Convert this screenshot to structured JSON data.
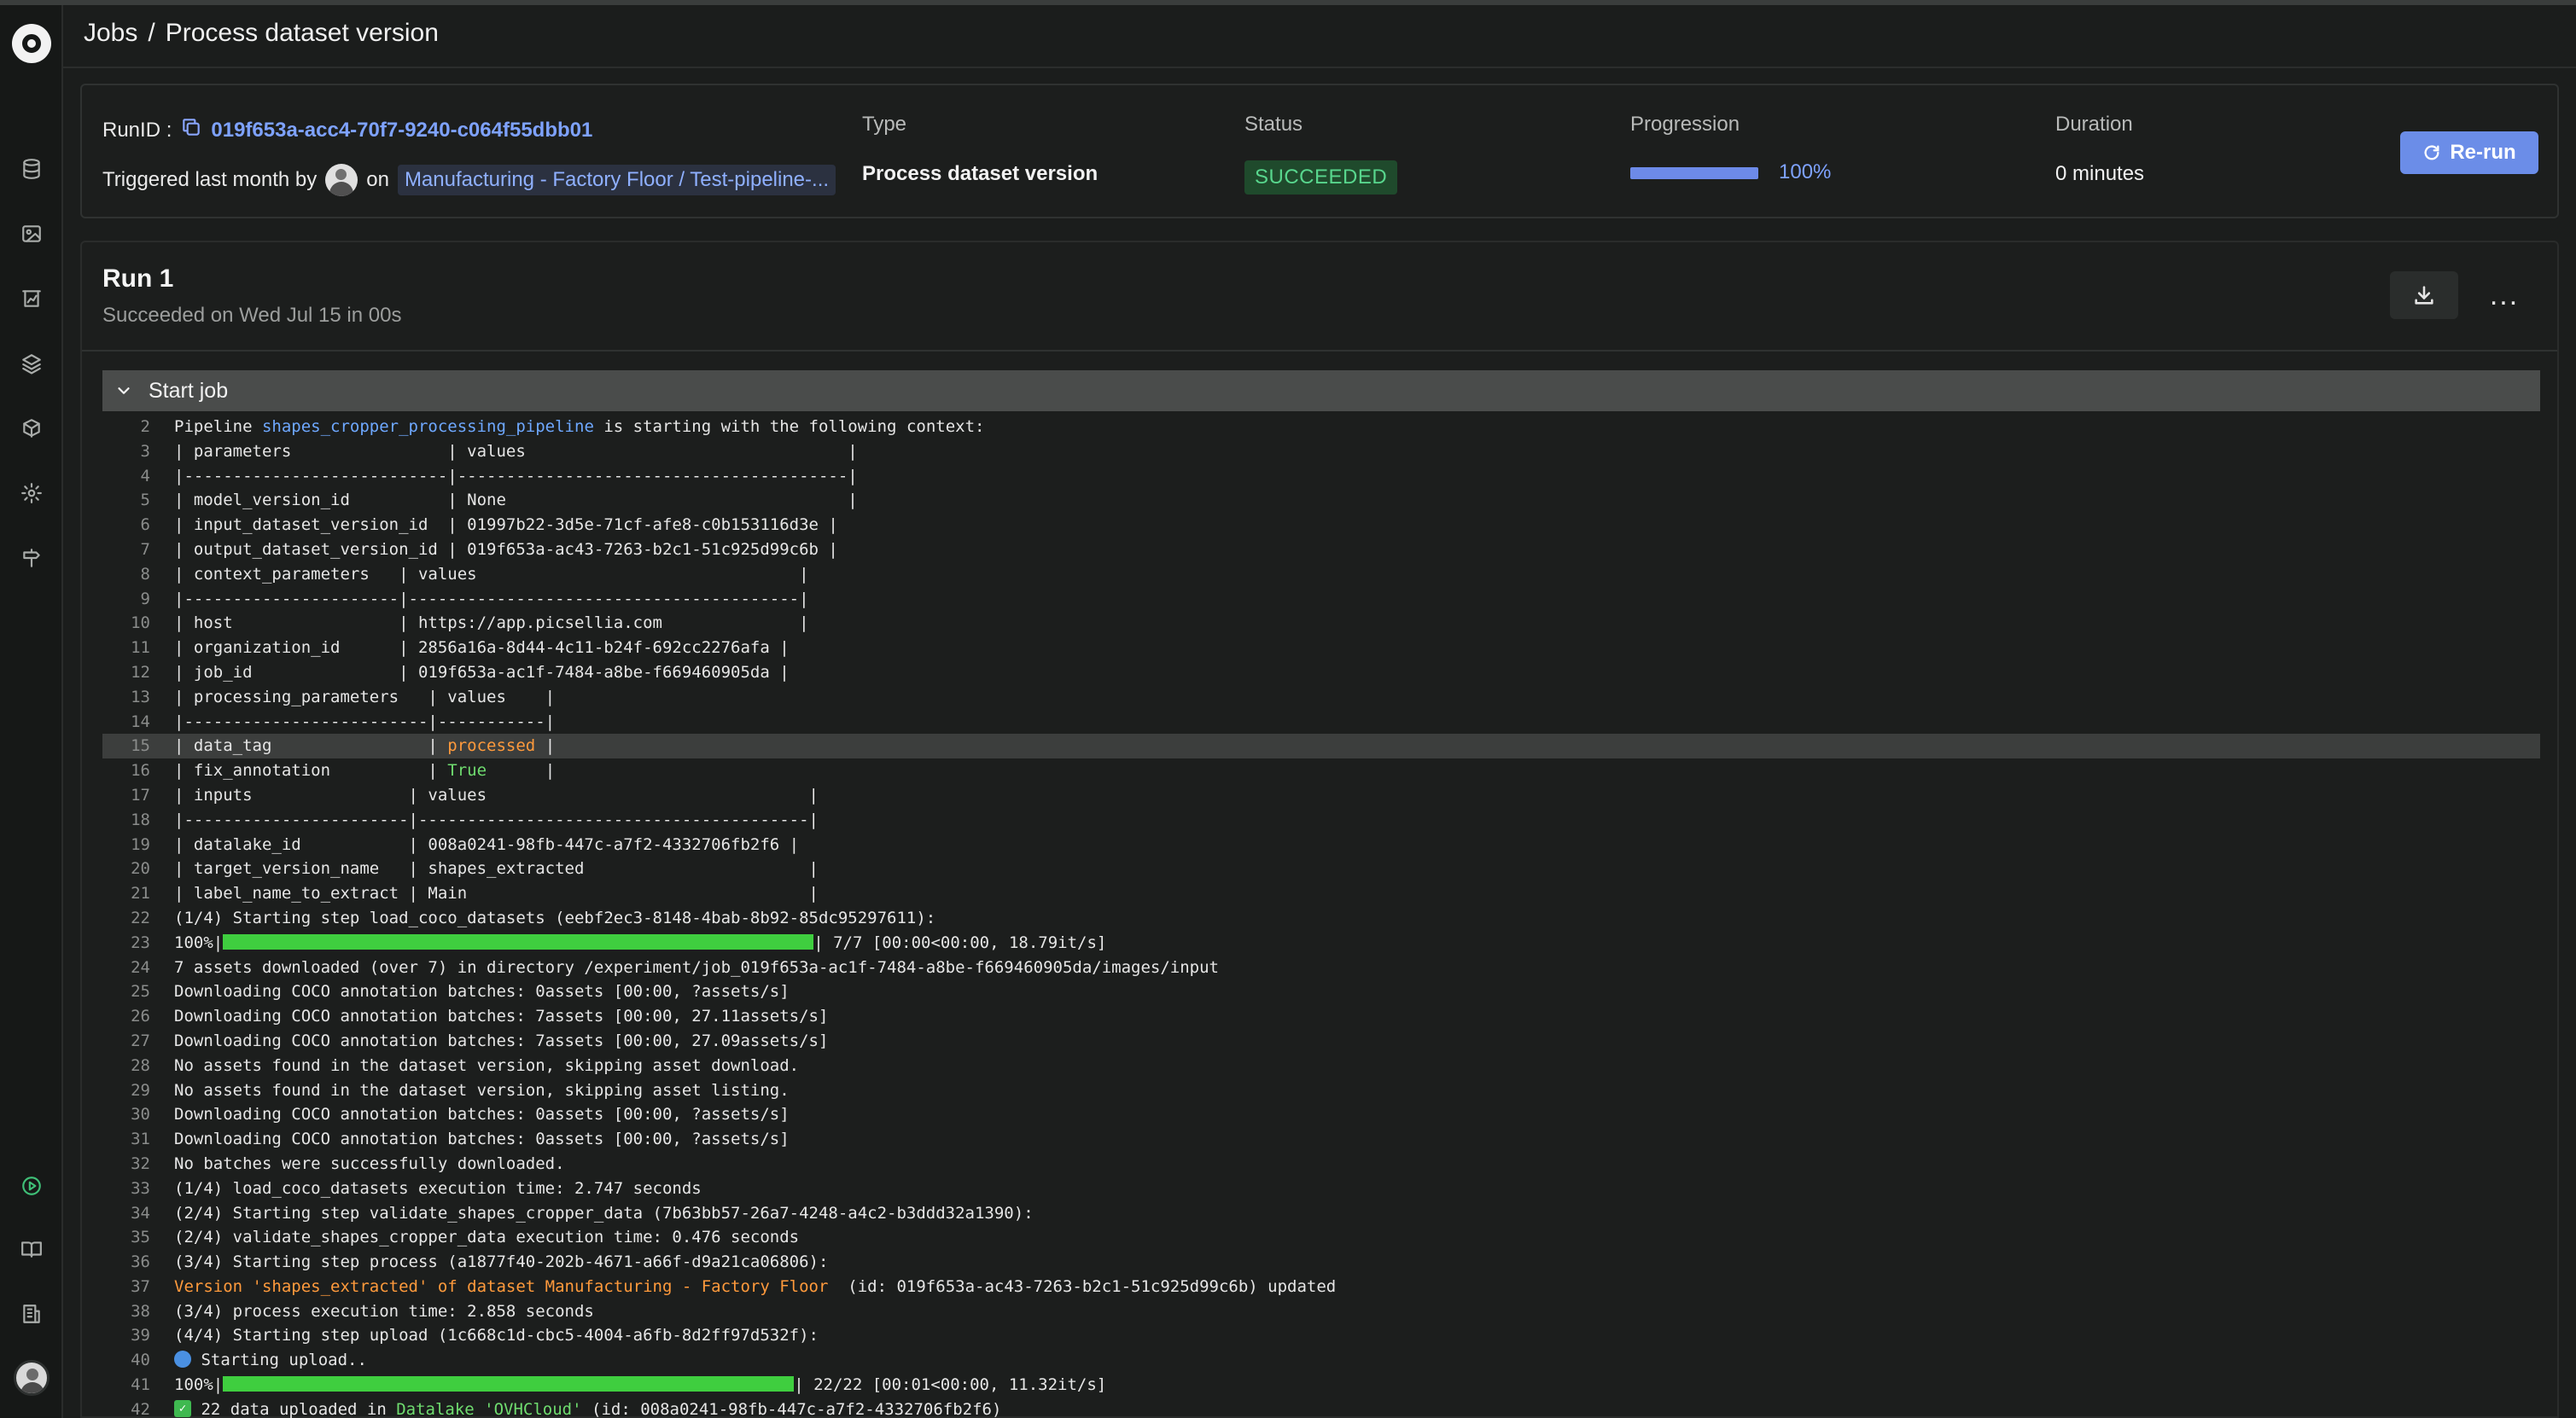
{
  "header": {
    "breadcrumb_jobs": "Jobs",
    "breadcrumb_sep": "/",
    "breadcrumb_current": "Process dataset version"
  },
  "run_info": {
    "runid_label": "RunID :",
    "runid_value": "019f653a-acc4-70f7-9240-c064f55dbb01",
    "triggered_prefix": "Triggered last month by",
    "triggered_on": "on",
    "project_link": "Manufacturing - Factory Floor / Test-pipeline-...",
    "type_label": "Type",
    "type_value": "Process dataset version",
    "status_label": "Status",
    "status_value": "SUCCEEDED",
    "progression_label": "Progression",
    "progression_value": "100%",
    "progression_fraction": 1.0,
    "duration_label": "Duration",
    "duration_value": "0 minutes",
    "rerun_label": "Re-run"
  },
  "run": {
    "title": "Run 1",
    "subtitle": "Succeeded on Wed Jul 15 in 00s",
    "more_label": "...",
    "section_title": "Start job"
  },
  "colors": {
    "accent": "#6b8de8",
    "success": "#58d68d",
    "link": "#7ea2ff",
    "log_orange": "#ff9a3c",
    "log_blue": "#6ea8ff",
    "log_green": "#6fdc6f"
  },
  "sidebar_icons": [
    "datasets-icon",
    "image-icon",
    "experiments-icon",
    "layers-icon",
    "models-icon",
    "settings-icon",
    "deployments-icon",
    "jobs-icon",
    "docs-icon",
    "organization-icon",
    "user-avatar"
  ],
  "log_lines": [
    {
      "n": "2",
      "parts": [
        {
          "t": "Pipeline "
        },
        {
          "t": "shapes_cropper_processing_pipeline",
          "c": "blue"
        },
        {
          "t": " is starting with the following context:"
        }
      ]
    },
    {
      "n": "3",
      "parts": [
        {
          "t": "| parameters                | values                                 |"
        }
      ]
    },
    {
      "n": "4",
      "parts": [
        {
          "t": "|---------------------------|----------------------------------------|"
        }
      ]
    },
    {
      "n": "5",
      "parts": [
        {
          "t": "| model_version_id          | None                                   |"
        }
      ]
    },
    {
      "n": "6",
      "parts": [
        {
          "t": "| input_dataset_version_id  | 01997b22-3d5e-71cf-afe8-c0b153116d3e |"
        }
      ]
    },
    {
      "n": "7",
      "parts": [
        {
          "t": "| output_dataset_version_id | 019f653a-ac43-7263-b2c1-51c925d99c6b |"
        }
      ]
    },
    {
      "n": "8",
      "parts": [
        {
          "t": "| context_parameters   | values                                 |"
        }
      ]
    },
    {
      "n": "9",
      "parts": [
        {
          "t": "|----------------------|----------------------------------------|"
        }
      ]
    },
    {
      "n": "10",
      "parts": [
        {
          "t": "| host                 | https://app.picsellia.com              |"
        }
      ]
    },
    {
      "n": "11",
      "parts": [
        {
          "t": "| organization_id      | 2856a16a-8d44-4c11-b24f-692cc2276afa |"
        }
      ]
    },
    {
      "n": "12",
      "parts": [
        {
          "t": "| job_id               | 019f653a-ac1f-7484-a8be-f669460905da |"
        }
      ]
    },
    {
      "n": "13",
      "parts": [
        {
          "t": "| processing_parameters   | values    |"
        }
      ]
    },
    {
      "n": "14",
      "parts": [
        {
          "t": "|-------------------------|-----------|"
        }
      ]
    },
    {
      "n": "15",
      "hl": true,
      "parts": [
        {
          "t": "| data_tag                | "
        },
        {
          "t": "processed",
          "c": "orange"
        },
        {
          "t": " |"
        }
      ]
    },
    {
      "n": "16",
      "parts": [
        {
          "t": "| fix_annotation          | "
        },
        {
          "t": "True",
          "c": "green"
        },
        {
          "t": "      |"
        }
      ]
    },
    {
      "n": "17",
      "parts": [
        {
          "t": "| inputs                | values                                 |"
        }
      ]
    },
    {
      "n": "18",
      "parts": [
        {
          "t": "|-----------------------|----------------------------------------|"
        }
      ]
    },
    {
      "n": "19",
      "parts": [
        {
          "t": "| datalake_id           | 008a0241-98fb-447c-a7f2-4332706fb2f6 |"
        }
      ]
    },
    {
      "n": "20",
      "parts": [
        {
          "t": "| target_version_name   | shapes_extracted                       |"
        }
      ]
    },
    {
      "n": "21",
      "parts": [
        {
          "t": "| label_name_to_extract | Main                                   |"
        }
      ]
    },
    {
      "n": "22",
      "parts": [
        {
          "t": "(1/4) Starting step load_coco_datasets (eebf2ec3-8148-4bab-8b92-85dc95297611):"
        }
      ]
    },
    {
      "n": "23",
      "bar": 0.92,
      "parts": [
        {
          "t": "100%|"
        },
        {
          "bar": true
        },
        {
          "t": "| 7/7 [00:00<00:00, 18.79it/s]"
        }
      ]
    },
    {
      "n": "24",
      "parts": [
        {
          "t": "7 assets downloaded (over 7) in directory /experiment/job_019f653a-ac1f-7484-a8be-f669460905da/images/input"
        }
      ]
    },
    {
      "n": "25",
      "parts": [
        {
          "t": "Downloading COCO annotation batches: 0assets [00:00, ?assets/s]"
        }
      ]
    },
    {
      "n": "26",
      "parts": [
        {
          "t": "Downloading COCO annotation batches: 7assets [00:00, 27.11assets/s]"
        }
      ]
    },
    {
      "n": "27",
      "parts": [
        {
          "t": "Downloading COCO annotation batches: 7assets [00:00, 27.09assets/s]"
        }
      ]
    },
    {
      "n": "28",
      "parts": [
        {
          "t": "No assets found in the dataset version, skipping asset download."
        }
      ]
    },
    {
      "n": "29",
      "parts": [
        {
          "t": "No assets found in the dataset version, skipping asset listing."
        }
      ]
    },
    {
      "n": "30",
      "parts": [
        {
          "t": "Downloading COCO annotation batches: 0assets [00:00, ?assets/s]"
        }
      ]
    },
    {
      "n": "31",
      "parts": [
        {
          "t": "Downloading COCO annotation batches: 0assets [00:00, ?assets/s]"
        }
      ]
    },
    {
      "n": "32",
      "parts": [
        {
          "t": "No batches were successfully downloaded."
        }
      ]
    },
    {
      "n": "33",
      "parts": [
        {
          "t": "(1/4) load_coco_datasets execution time: 2.747 seconds"
        }
      ]
    },
    {
      "n": "34",
      "parts": [
        {
          "t": "(2/4) Starting step validate_shapes_cropper_data (7b63bb57-26a7-4248-a4c2-b3ddd32a1390):"
        }
      ]
    },
    {
      "n": "35",
      "parts": [
        {
          "t": "(2/4) validate_shapes_cropper_data execution time: 0.476 seconds"
        }
      ]
    },
    {
      "n": "36",
      "parts": [
        {
          "t": "(3/4) Starting step process (a1877f40-202b-4671-a66f-d9a21ca06806):"
        }
      ]
    },
    {
      "n": "37",
      "parts": [
        {
          "t": "Version 'shapes_extracted' of dataset Manufacturing - Factory Floor ",
          "c": "orange"
        },
        {
          "t": " (id: 019f653a-ac43-7263-b2c1-51c925d99c6b) updated"
        }
      ]
    },
    {
      "n": "38",
      "parts": [
        {
          "t": "(3/4) process execution time: 2.858 seconds"
        }
      ]
    },
    {
      "n": "39",
      "parts": [
        {
          "t": "(4/4) Starting step upload (1c668c1d-cbc5-4004-a6fb-8d2ff97d532f):"
        }
      ]
    },
    {
      "n": "40",
      "parts": [
        {
          "globe": true
        },
        {
          "t": " Starting upload.."
        }
      ]
    },
    {
      "n": "41",
      "parts": [
        {
          "t": "100%|"
        },
        {
          "bar": true,
          "w": 0.89
        },
        {
          "t": "| 22/22 [00:01<00:00, 11.32it/s]"
        }
      ]
    },
    {
      "n": "42",
      "parts": [
        {
          "check": true
        },
        {
          "t": " 22 data uploaded in "
        },
        {
          "t": "Datalake 'OVHCloud'",
          "c": "green"
        },
        {
          "t": " (id: 008a0241-98fb-447c-a7f2-4332706fb2f6)"
        }
      ]
    }
  ]
}
